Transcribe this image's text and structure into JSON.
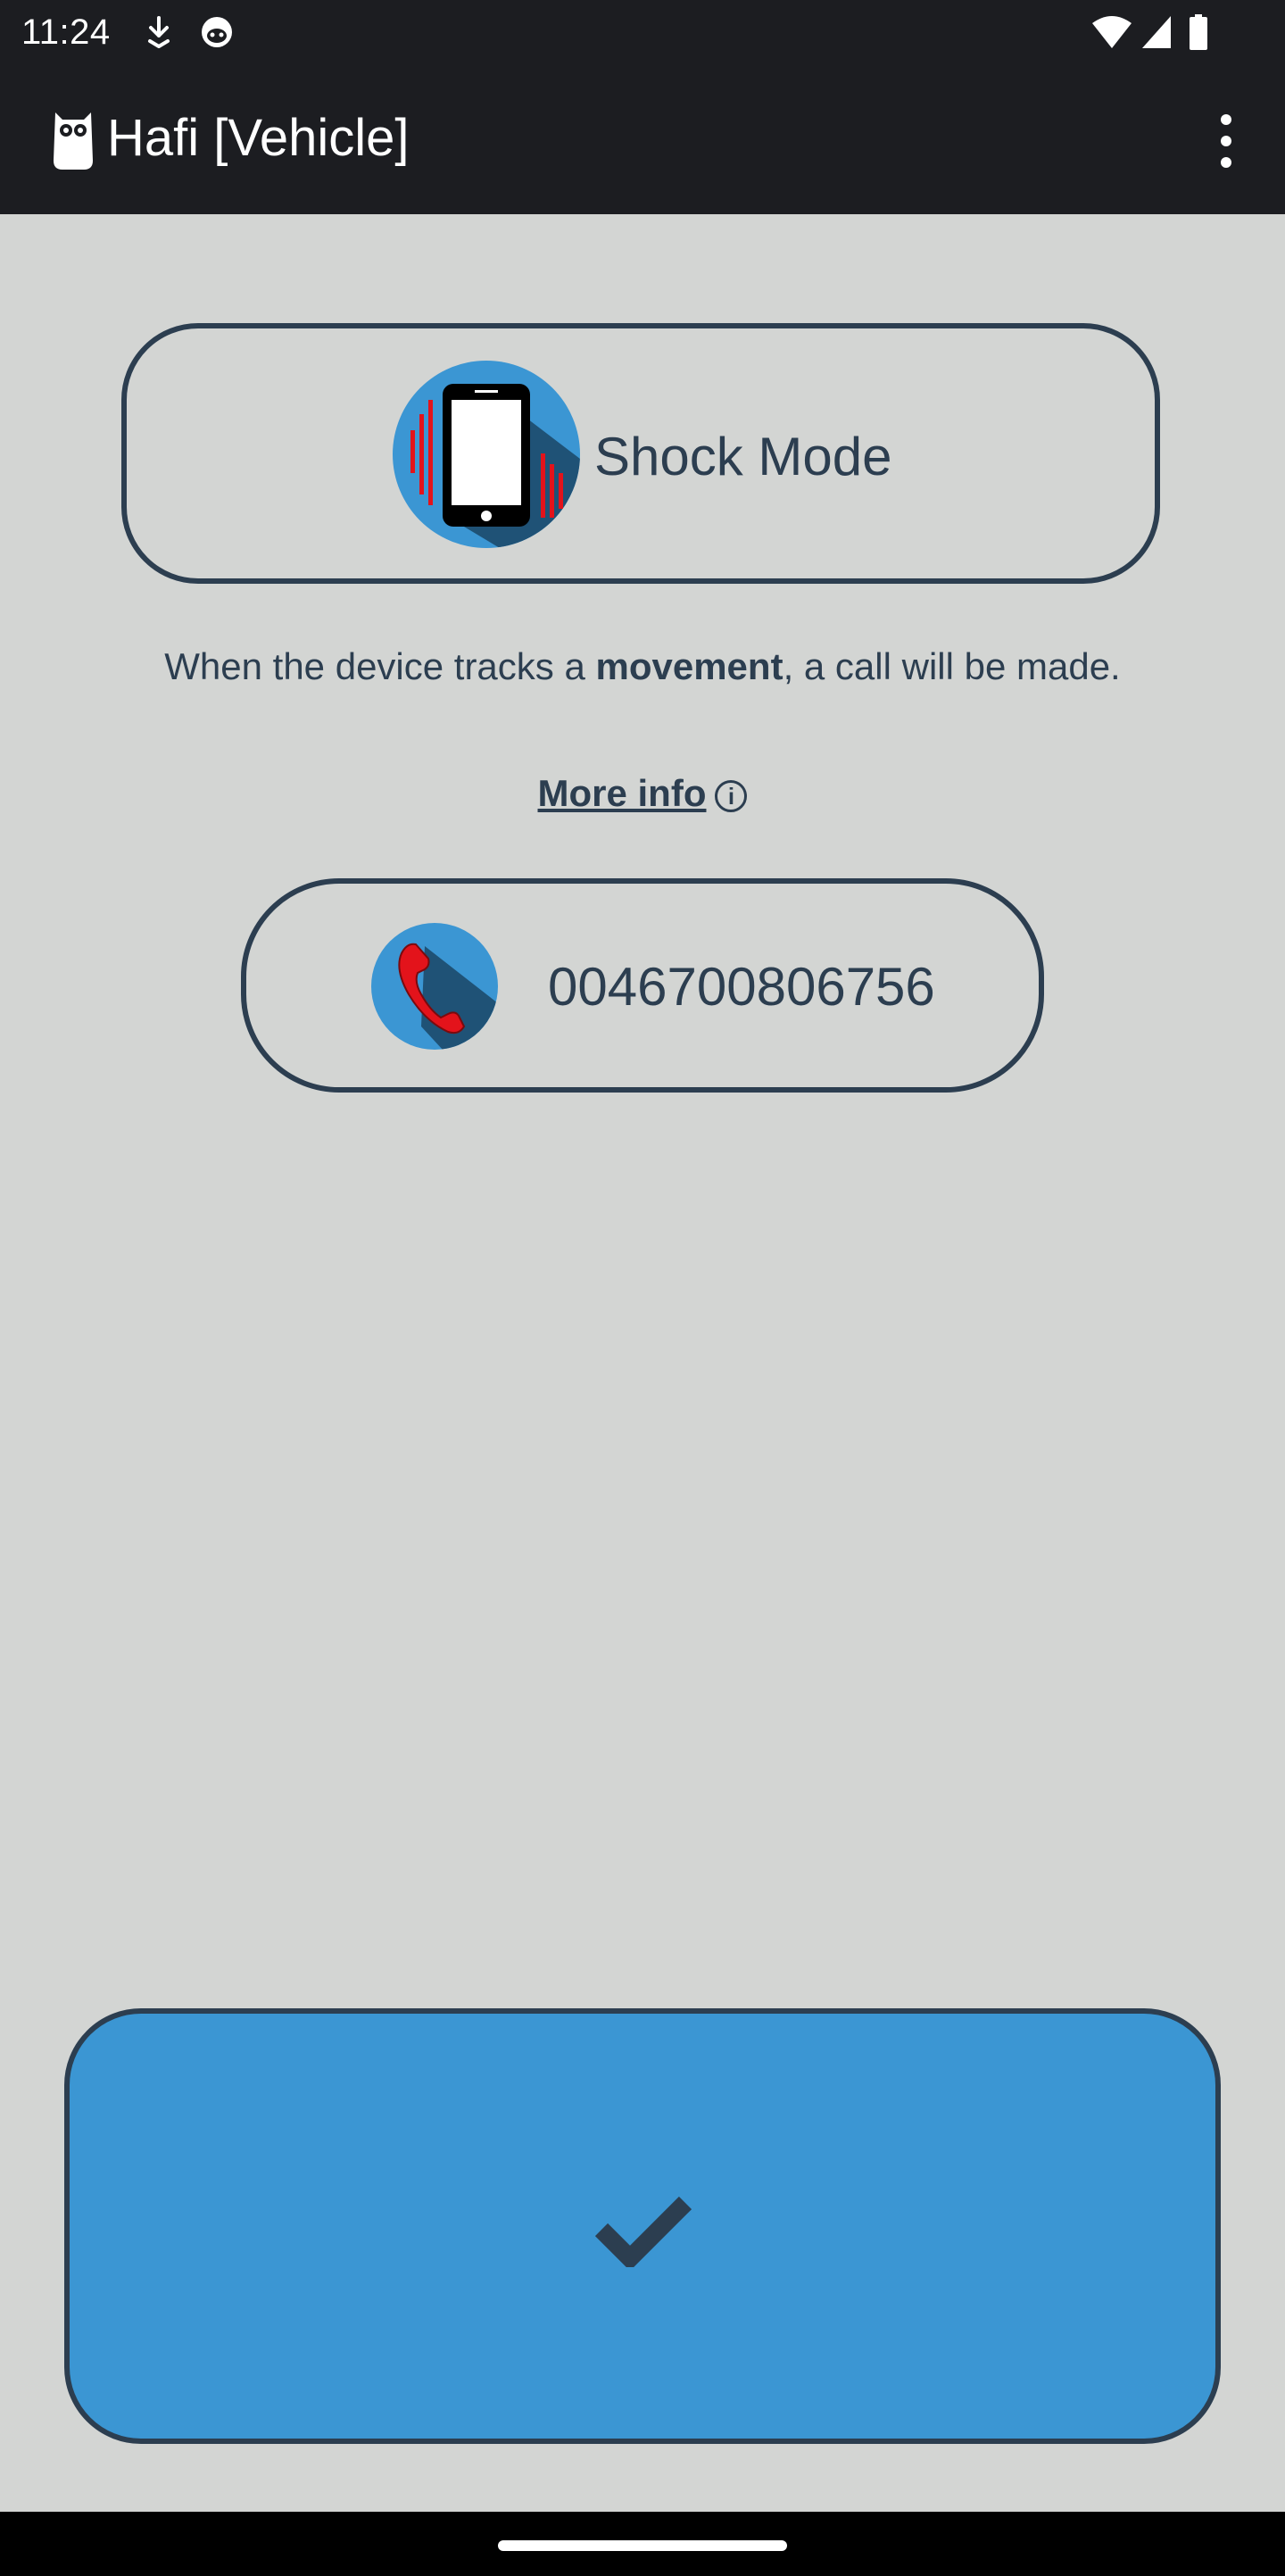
{
  "status_bar": {
    "time": "11:24",
    "icons": [
      "download-icon",
      "android-robot-icon",
      "wifi-icon",
      "signal-icon",
      "battery-icon"
    ]
  },
  "app_bar": {
    "logo": "owl-logo-icon",
    "title": "Hafi [Vehicle]",
    "menu_icon": "more-vert-icon"
  },
  "mode": {
    "icon": "vibrating-phone-icon",
    "label": "Shock Mode"
  },
  "description": {
    "before": "When the device tracks a ",
    "bold": "movement",
    "after": ", a call will be made."
  },
  "more_info": {
    "label": "More info",
    "icon": "info-circle-icon"
  },
  "phone": {
    "icon": "phone-call-icon",
    "number": "0046700806756"
  },
  "confirm": {
    "icon": "checkmark-icon"
  },
  "colors": {
    "background": "#d3d5d3",
    "bar": "#1c1d21",
    "text": "#2c3e50",
    "accent_blue": "#3b96d3",
    "icon_dark_blue": "#1f5276",
    "alert_red": "#e3131b"
  }
}
